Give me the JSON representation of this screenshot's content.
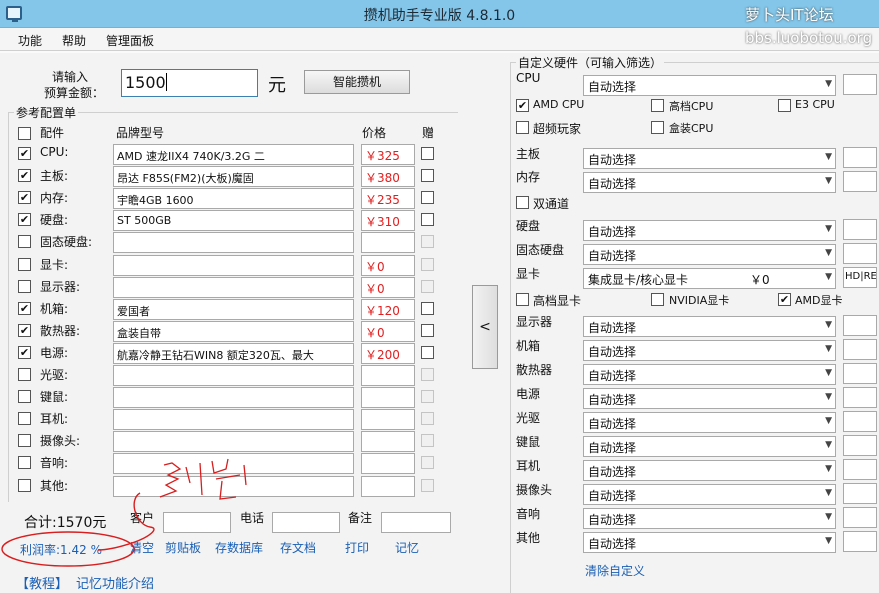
{
  "title": "攒机助手专业版 4.8.1.0",
  "watermark": {
    "line1": "萝卜头IT论坛",
    "line2": "bbs.luobotou.org"
  },
  "menu": [
    "功能",
    "帮助",
    "管理面板"
  ],
  "budget": {
    "label1": "请输入",
    "label2": "预算金额：",
    "value": "1500",
    "unit": "元",
    "button": "智能攒机"
  },
  "ref_title": "参考配置单",
  "headers": {
    "part": "配件",
    "model": "品牌型号",
    "price": "价格",
    "gift": "赠"
  },
  "rows": [
    {
      "label": "CPU:",
      "checked": true,
      "model": "AMD 速龙IIX4 740K/3.2G  二",
      "price": "￥325"
    },
    {
      "label": "主板:",
      "checked": true,
      "model": "昂达 F85S(FM2)(大板)魔固",
      "price": "￥380"
    },
    {
      "label": "内存:",
      "checked": true,
      "model": "宇瞻4GB  1600",
      "price": "￥235"
    },
    {
      "label": "硬盘:",
      "checked": true,
      "model": "ST 500GB",
      "price": "￥310"
    },
    {
      "label": "固态硬盘:",
      "checked": false,
      "model": "",
      "price": ""
    },
    {
      "label": "显卡:",
      "checked": false,
      "model": "",
      "price": "￥0"
    },
    {
      "label": "显示器:",
      "checked": false,
      "model": "",
      "price": "￥0"
    },
    {
      "label": "机箱:",
      "checked": true,
      "model": "爱国者",
      "price": "￥120"
    },
    {
      "label": "散热器:",
      "checked": true,
      "model": "盒装自带",
      "price": "￥0"
    },
    {
      "label": "电源:",
      "checked": true,
      "model": "航嘉冷静王钻石WIN8      额定320瓦、最大",
      "price": "￥200"
    },
    {
      "label": "光驱:",
      "checked": false,
      "model": "",
      "price": ""
    },
    {
      "label": "键鼠:",
      "checked": false,
      "model": "",
      "price": ""
    },
    {
      "label": "耳机:",
      "checked": false,
      "model": "",
      "price": ""
    },
    {
      "label": "摄像头:",
      "checked": false,
      "model": "",
      "price": ""
    },
    {
      "label": "音响:",
      "checked": false,
      "model": "",
      "price": ""
    },
    {
      "label": "其他:",
      "checked": false,
      "model": "",
      "price": ""
    }
  ],
  "gift_enabled": [
    true,
    true,
    true,
    true,
    false,
    false,
    false,
    true,
    true,
    true,
    false,
    false,
    false,
    false,
    false,
    false
  ],
  "total": "合计:1570元",
  "profit": "利润率:1.42 %",
  "customer": {
    "label": "客户",
    "phone": "电话",
    "note": "备注"
  },
  "actions": [
    "清空",
    "剪贴板",
    "存数据库",
    "存文档",
    "打印",
    "记忆"
  ],
  "tutorial": {
    "tag": "【教程】",
    "text": "记忆功能介绍"
  },
  "collapse_arrow": "<",
  "custom": {
    "title": "自定义硬件（可输入筛选）",
    "cpu_label": "CPU",
    "cpu_value": "自动选择",
    "opts1": [
      {
        "label": "AMD CPU",
        "checked": true
      },
      {
        "label": "高档CPU",
        "checked": false
      },
      {
        "label": "E3 CPU",
        "checked": false
      }
    ],
    "opts2": [
      {
        "label": "超频玩家",
        "checked": false
      },
      {
        "label": "盒装CPU",
        "checked": false
      }
    ],
    "mb_label": "主板",
    "mb_value": "自动选择",
    "mem_label": "内存",
    "mem_value": "自动选择",
    "dual_label": "双通道",
    "hdd_label": "硬盘",
    "hdd_value": "自动选择",
    "ssd_label": "固态硬盘",
    "ssd_value": "自动选择",
    "gpu_label": "显卡",
    "gpu_value": "集成显卡/核心显卡",
    "gpu_price": "￥0",
    "hd_text": "HD|RE",
    "gpu_opts": [
      {
        "label": "高档显卡",
        "checked": false
      },
      {
        "label": "NVIDIA显卡",
        "checked": false
      },
      {
        "label": "AMD显卡",
        "checked": true
      }
    ],
    "lower": [
      {
        "label": "显示器",
        "value": "自动选择"
      },
      {
        "label": "机箱",
        "value": "自动选择"
      },
      {
        "label": "散热器",
        "value": "自动选择"
      },
      {
        "label": "电源",
        "value": "自动选择"
      },
      {
        "label": "光驱",
        "value": "自动选择"
      },
      {
        "label": "键鼠",
        "value": "自动选择"
      },
      {
        "label": "耳机",
        "value": "自动选择"
      },
      {
        "label": "摄像头",
        "value": "自动选择"
      },
      {
        "label": "音响",
        "value": "自动选择"
      },
      {
        "label": "其他",
        "value": "自动选择"
      }
    ],
    "clear": "清除自定义"
  },
  "colors": {
    "price": "#e02020",
    "link": "#1a5fb4",
    "annotation": "#d81e1e",
    "titlebar": "#83c6e9"
  }
}
